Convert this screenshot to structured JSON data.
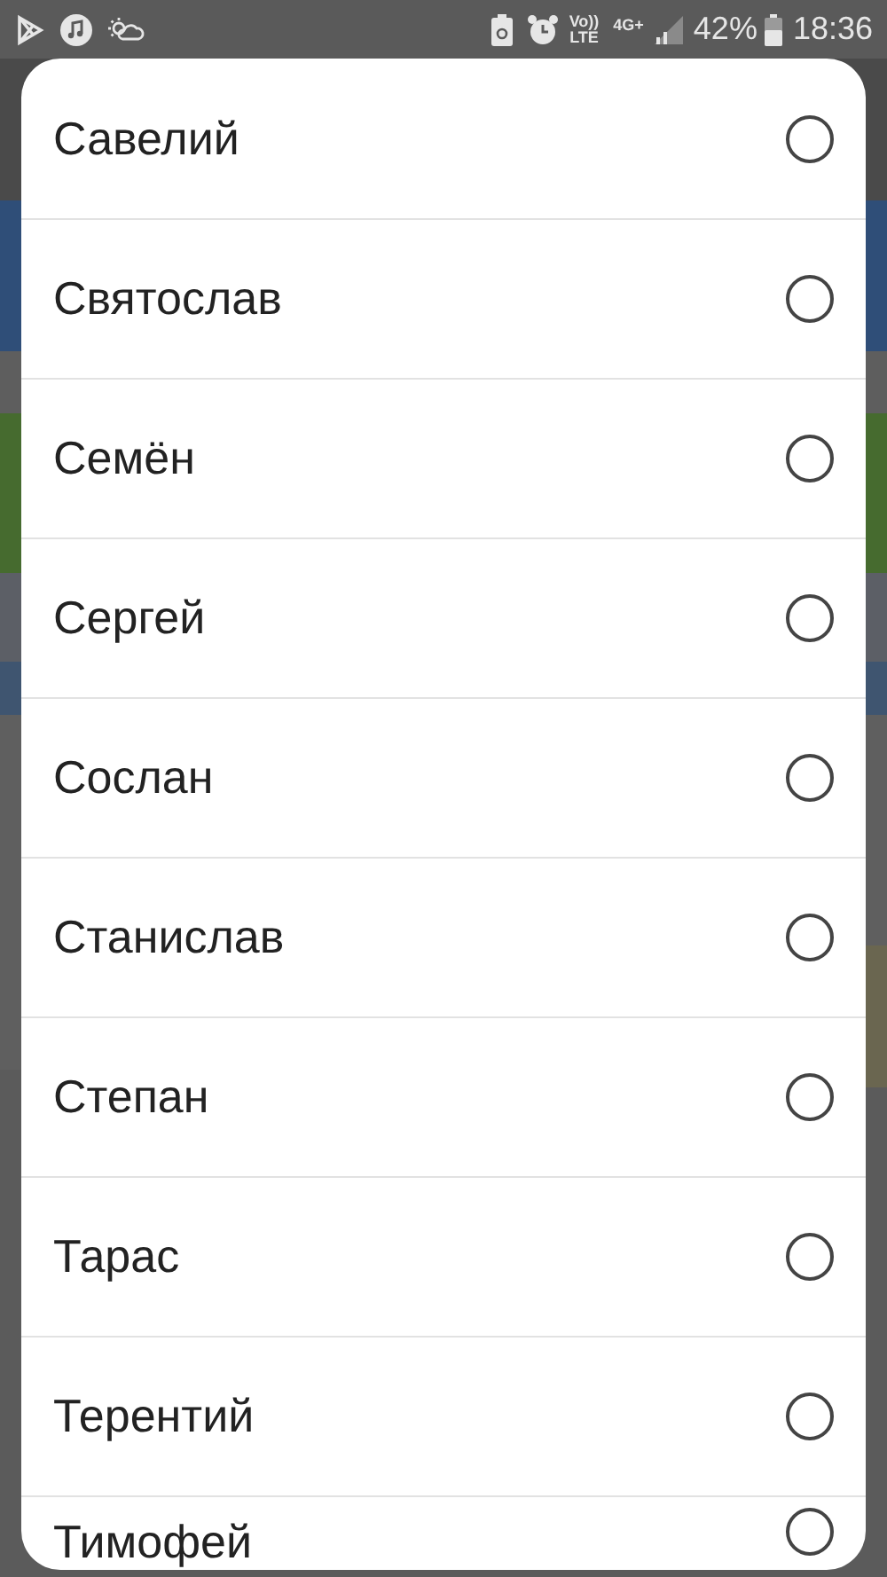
{
  "status_bar": {
    "network_voice": "Vo))",
    "network_lte": "LTE",
    "network_type": "4G+",
    "battery": "42%",
    "time": "18:36"
  },
  "options": [
    {
      "label": "Савелий",
      "selected": false
    },
    {
      "label": "Святослав",
      "selected": false
    },
    {
      "label": "Семён",
      "selected": false
    },
    {
      "label": "Сергей",
      "selected": false
    },
    {
      "label": "Сослан",
      "selected": false
    },
    {
      "label": "Станислав",
      "selected": false
    },
    {
      "label": "Степан",
      "selected": false
    },
    {
      "label": "Тарас",
      "selected": false
    },
    {
      "label": "Терентий",
      "selected": false
    },
    {
      "label": "Тимофей",
      "selected": false
    }
  ]
}
